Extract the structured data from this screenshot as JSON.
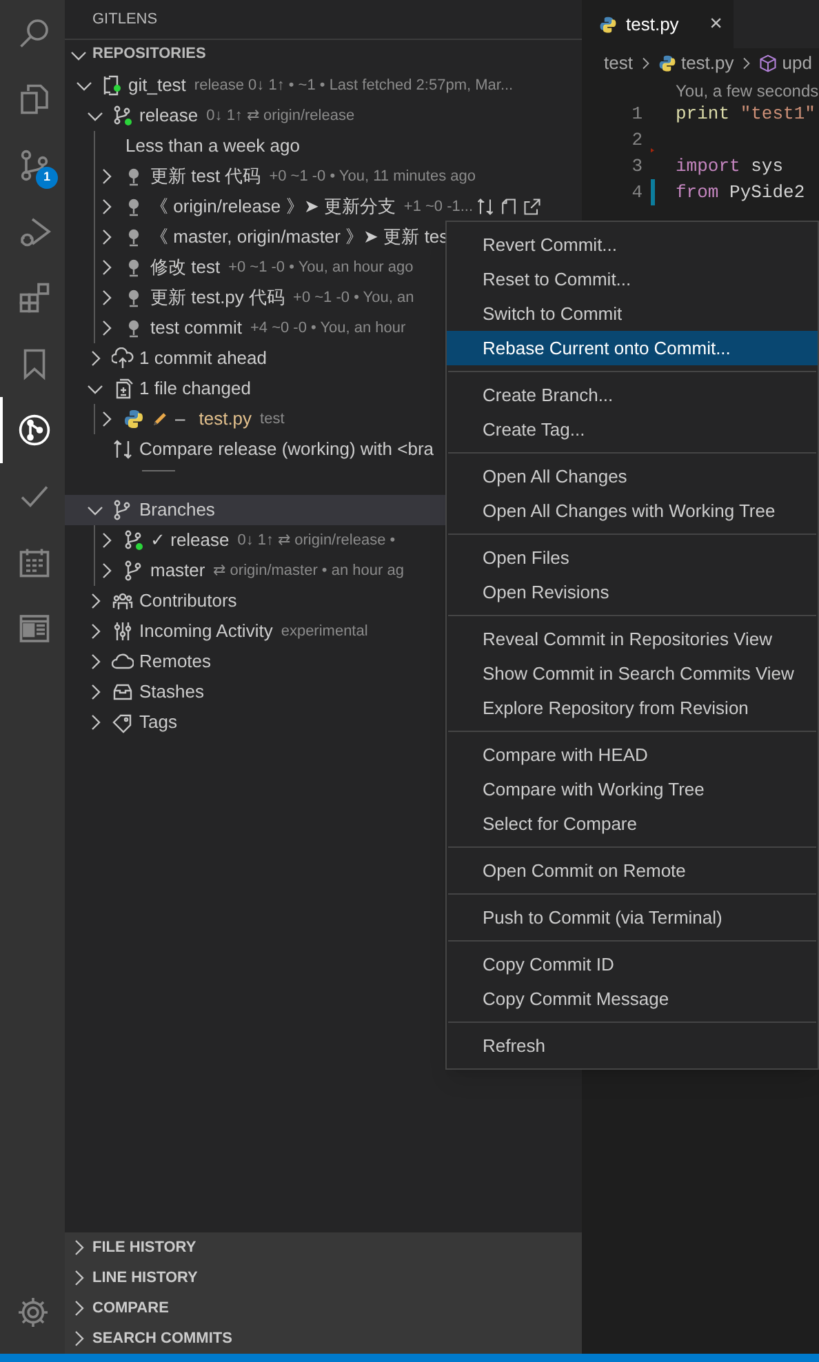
{
  "activity_bar": {
    "items": [
      {
        "kind": "search",
        "selected": false
      },
      {
        "kind": "files",
        "selected": false
      },
      {
        "kind": "source-control",
        "selected": false,
        "badge": "1"
      },
      {
        "kind": "run",
        "selected": false
      },
      {
        "kind": "extensions",
        "selected": false
      },
      {
        "kind": "bookmark",
        "selected": false
      },
      {
        "kind": "gitlens",
        "selected": true
      },
      {
        "kind": "check",
        "selected": false
      },
      {
        "kind": "calendar",
        "selected": false
      },
      {
        "kind": "layout",
        "selected": false
      }
    ],
    "settings": {
      "kind": "gear"
    }
  },
  "sidebar": {
    "title": "GITLENS",
    "repositories": {
      "title": "REPOSITORIES",
      "expanded": true,
      "tree": [
        {
          "kind": "repo",
          "label": "git_test",
          "description": "release 0↓ 1↑ • ~1 • Last fetched 2:57pm, Mar...",
          "expanded": true,
          "selected": false,
          "children": [
            {
              "kind": "branch-current",
              "label": "release",
              "description": "0↓ 1↑ ⇄ origin/release",
              "expanded": true,
              "selected": false,
              "children": [
                {
                  "kind": "date-group",
                  "label": "Less than a week ago",
                  "selected": false
                },
                {
                  "kind": "commit",
                  "label": "更新 test 代码",
                  "description": "+0 ~1 -0 • You, 11 minutes ago",
                  "expanded": false,
                  "selected": false,
                  "hovered": false
                },
                {
                  "kind": "commit",
                  "label": "《 origin/release 》➤ 更新分支",
                  "description": "+1 ~0 -1...",
                  "expanded": false,
                  "selected": false,
                  "hovered": true
                },
                {
                  "kind": "commit",
                  "label": "《 master, origin/master 》➤ 更新 tes",
                  "expanded": false,
                  "selected": false,
                  "hovered": false
                },
                {
                  "kind": "commit",
                  "label": "修改 test",
                  "description": "+0 ~1 -0 • You, an hour ago",
                  "expanded": false,
                  "selected": false,
                  "hovered": false
                },
                {
                  "kind": "commit",
                  "label": "更新 test.py 代码",
                  "description": "+0 ~1 -0 • You, an",
                  "expanded": false,
                  "selected": false,
                  "hovered": false
                },
                {
                  "kind": "commit",
                  "label": "test commit",
                  "description": "+4 ~0 -0 • You, an hour",
                  "expanded": false,
                  "selected": false,
                  "hovered": false
                }
              ]
            },
            {
              "kind": "ahead",
              "label": "1 commit ahead",
              "expanded": false,
              "selected": false
            },
            {
              "kind": "files-changed",
              "label": "1 file changed",
              "expanded": true,
              "selected": false,
              "children": [
                {
                  "kind": "python-file",
                  "status": "–",
                  "label": "test.py",
                  "description": "test",
                  "expanded": false,
                  "selected": false
                }
              ]
            },
            {
              "kind": "compare",
              "label": "Compare release (working) with <bra",
              "selected": false
            },
            {
              "kind": "divider",
              "selected": false
            },
            {
              "kind": "branches",
              "label": "Branches",
              "expanded": true,
              "selected": true,
              "children": [
                {
                  "kind": "branch-current",
                  "label": "✓ release",
                  "description": "0↓ 1↑ ⇄ origin/release •",
                  "expanded": false,
                  "selected": false
                },
                {
                  "kind": "branch",
                  "label": "master",
                  "description": "⇄ origin/master • an hour ag",
                  "expanded": false,
                  "selected": false
                }
              ]
            },
            {
              "kind": "contributors",
              "label": "Contributors",
              "expanded": false,
              "selected": false
            },
            {
              "kind": "activity",
              "label": "Incoming Activity",
              "description": "experimental",
              "expanded": false,
              "selected": false
            },
            {
              "kind": "remotes",
              "label": "Remotes",
              "expanded": false,
              "selected": false
            },
            {
              "kind": "stashes",
              "label": "Stashes",
              "expanded": false,
              "selected": false
            },
            {
              "kind": "tags",
              "label": "Tags",
              "expanded": false,
              "selected": false
            }
          ]
        }
      ]
    },
    "sections": [
      {
        "title": "FILE HISTORY",
        "expanded": false
      },
      {
        "title": "LINE HISTORY",
        "expanded": false
      },
      {
        "title": "COMPARE",
        "expanded": false
      },
      {
        "title": "SEARCH COMMITS",
        "expanded": false
      }
    ]
  },
  "editor": {
    "tabs": [
      {
        "label": "test.py",
        "selected": true,
        "close": "×"
      }
    ],
    "breadcrumbs": [
      {
        "kind": "folder",
        "label": "test"
      },
      {
        "kind": "python-file",
        "label": "test.py"
      },
      {
        "kind": "symbol",
        "label": "upd"
      }
    ],
    "codelens": "You, a few seconds",
    "lines": [
      {
        "number": "1",
        "deleted": false,
        "modified": false,
        "tokens": [
          {
            "kind": "function",
            "text": "print"
          },
          {
            "kind": "string",
            "text": "\"test1\""
          }
        ]
      },
      {
        "number": "2",
        "deleted": false,
        "modified": false
      },
      {
        "number": "3",
        "deleted": true,
        "modified": false,
        "tokens": [
          {
            "kind": "keyword",
            "text": "import"
          },
          {
            "kind": "plain",
            "text": "sys"
          }
        ]
      },
      {
        "number": "4",
        "deleted": false,
        "modified": true,
        "tokens": [
          {
            "kind": "keyword",
            "text": "from"
          },
          {
            "kind": "plain",
            "text": "PySide2"
          }
        ]
      }
    ]
  },
  "context_menu": {
    "groups": [
      [
        {
          "label": "Revert Commit...",
          "selected": false
        },
        {
          "label": "Reset to Commit...",
          "selected": false
        },
        {
          "label": "Switch to Commit",
          "selected": false
        },
        {
          "label": "Rebase Current onto Commit...",
          "selected": true
        }
      ],
      [
        {
          "label": "Create Branch...",
          "selected": false
        },
        {
          "label": "Create Tag...",
          "selected": false
        }
      ],
      [
        {
          "label": "Open All Changes",
          "selected": false
        },
        {
          "label": "Open All Changes with Working Tree",
          "selected": false
        }
      ],
      [
        {
          "label": "Open Files",
          "selected": false
        },
        {
          "label": "Open Revisions",
          "selected": false
        }
      ],
      [
        {
          "label": "Reveal Commit in Repositories View",
          "selected": false
        },
        {
          "label": "Show Commit in Search Commits View",
          "selected": false
        },
        {
          "label": "Explore Repository from Revision",
          "selected": false
        }
      ],
      [
        {
          "label": "Compare with HEAD",
          "selected": false
        },
        {
          "label": "Compare with Working Tree",
          "selected": false
        },
        {
          "label": "Select for Compare",
          "selected": false
        }
      ],
      [
        {
          "label": "Open Commit on Remote",
          "selected": false
        }
      ],
      [
        {
          "label": "Push to Commit (via Terminal)",
          "selected": false
        }
      ],
      [
        {
          "label": "Copy Commit ID",
          "selected": false
        },
        {
          "label": "Copy Commit Message",
          "selected": false
        }
      ],
      [
        {
          "label": "Refresh",
          "selected": false
        }
      ]
    ]
  }
}
